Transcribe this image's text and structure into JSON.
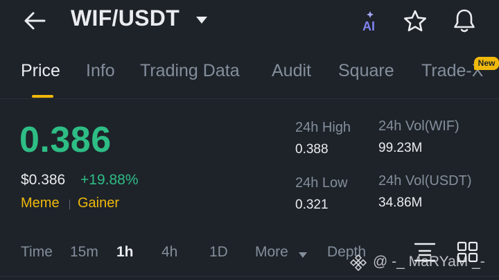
{
  "header": {
    "pair": "WIF/USDT",
    "ai_label": "AI"
  },
  "tabs": [
    {
      "label": "Price"
    },
    {
      "label": "Info"
    },
    {
      "label": "Trading Data"
    },
    {
      "label": "Audit"
    },
    {
      "label": "Square"
    },
    {
      "label": "Trade-X"
    }
  ],
  "new_badge": "New",
  "price": {
    "last": "0.386",
    "usd": "$0.386",
    "change": "+19.88%",
    "tags": [
      "Meme",
      "Gainer"
    ]
  },
  "stats": {
    "high_label": "24h High",
    "high_value": "0.388",
    "low_label": "24h Low",
    "low_value": "0.321",
    "vol_base_label": "24h Vol(WIF)",
    "vol_base_value": "99.23M",
    "vol_quote_label": "24h Vol(USDT)",
    "vol_quote_value": "34.86M"
  },
  "chart_tabs": [
    {
      "label": "Time"
    },
    {
      "label": "15m"
    },
    {
      "label": "1h"
    },
    {
      "label": "4h"
    },
    {
      "label": "1D"
    },
    {
      "label": "More"
    },
    {
      "label": "Depth"
    }
  ],
  "watermark": "@ -_ MaRYaM _-",
  "colors": {
    "background": "#1e2329",
    "up": "#2ebd85",
    "accent": "#f0b90b",
    "muted": "#848e9c",
    "text": "#eaecef"
  },
  "icons": [
    "back-arrow-icon",
    "caret-down-icon",
    "ai-icon",
    "star-icon",
    "bell-icon",
    "chart-settings-icon",
    "grid-layout-icon",
    "binance-logo-icon"
  ]
}
